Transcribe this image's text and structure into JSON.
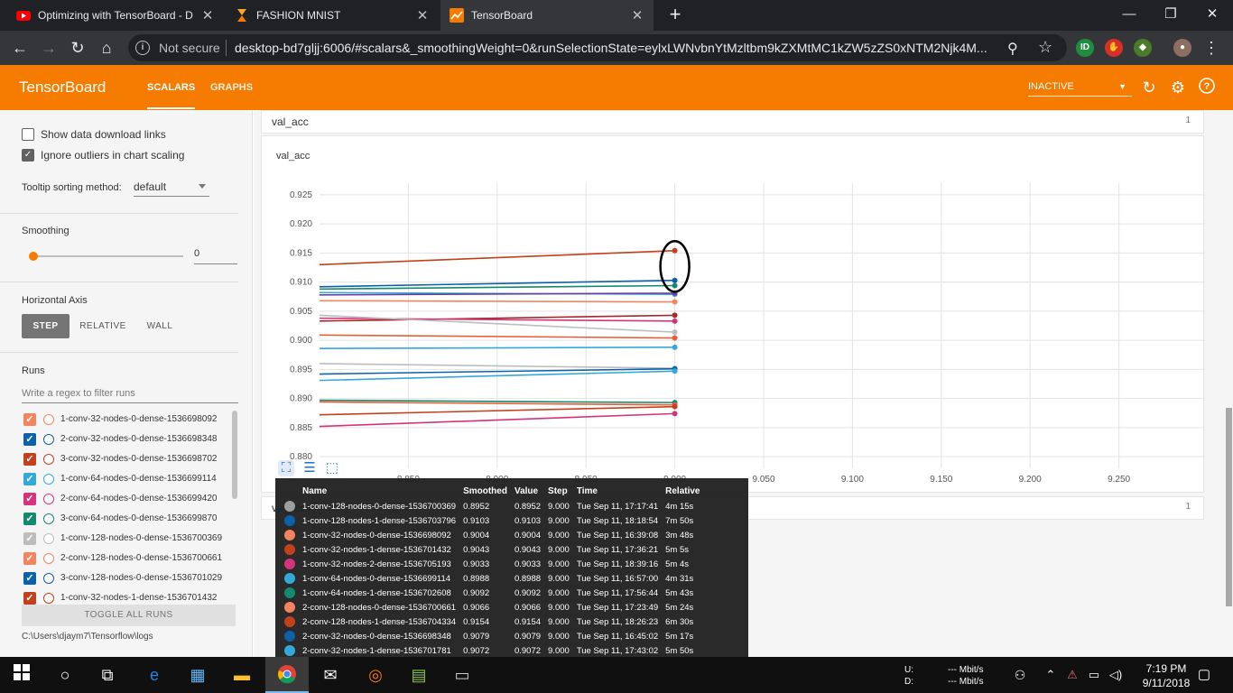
{
  "browser": {
    "tabs": [
      {
        "title": "Optimizing with TensorBoard - D",
        "icon": "youtube-icon"
      },
      {
        "title": "FASHION MNIST",
        "icon": "hourglass-icon"
      },
      {
        "title": "TensorBoard",
        "icon": "tensorboard-icon"
      }
    ],
    "security_label": "Not secure",
    "url": "desktop-bd7gljj:6006/#scalars&_smoothingWeight=0&runSelectionState=eylxLWNvbnYtMzltbm9kZXMtMC1kZW5zZS0xNTM2Njk4M..."
  },
  "tensorboard": {
    "brand": "TensorBoard",
    "nav": [
      "SCALARS",
      "GRAPHS"
    ],
    "status": "INACTIVE",
    "accent": "#f57c00"
  },
  "sidebar": {
    "show_download_links": "Show data download links",
    "ignore_outliers": "Ignore outliers in chart scaling",
    "tooltip_sorting_label": "Tooltip sorting method:",
    "tooltip_sorting_value": "default",
    "smoothing_label": "Smoothing",
    "smoothing_value": "0",
    "horizontal_axis_label": "Horizontal Axis",
    "axis_options": [
      "STEP",
      "RELATIVE",
      "WALL"
    ],
    "runs_label": "Runs",
    "runs_filter_placeholder": "Write a regex to filter runs",
    "runs": [
      {
        "name": "1-conv-32-nodes-0-dense-1536698092",
        "color": "#f4845f"
      },
      {
        "name": "2-conv-32-nodes-0-dense-1536698348",
        "color": "#0c61a8"
      },
      {
        "name": "3-conv-32-nodes-0-dense-1536698702",
        "color": "#c2401c"
      },
      {
        "name": "1-conv-64-nodes-0-dense-1536699114",
        "color": "#33a9d9"
      },
      {
        "name": "2-conv-64-nodes-0-dense-1536699420",
        "color": "#d6337a"
      },
      {
        "name": "3-conv-64-nodes-0-dense-1536699870",
        "color": "#138a6e"
      },
      {
        "name": "1-conv-128-nodes-0-dense-1536700369",
        "color": "#bdbdbd"
      },
      {
        "name": "2-conv-128-nodes-0-dense-1536700661",
        "color": "#f4845f"
      },
      {
        "name": "3-conv-128-nodes-0-dense-1536701029",
        "color": "#0c61a8"
      },
      {
        "name": "1-conv-32-nodes-1-dense-1536701432",
        "color": "#c2401c"
      }
    ],
    "toggle_all": "TOGGLE ALL RUNS",
    "logdir": "C:\\Users\\djaym7\\Tensorflow\\logs"
  },
  "main": {
    "card_title": "val_acc",
    "card_count": "1",
    "chart_title": "val_acc",
    "second_card_title": "val_loss",
    "second_card_count": "1"
  },
  "chart_data": {
    "type": "line",
    "title": "val_acc",
    "xlabel": "",
    "ylabel": "",
    "xlim": [
      8.8,
      9.3
    ],
    "ylim": [
      0.878,
      0.927
    ],
    "x_ticks": [
      "8.850",
      "8.900",
      "8.950",
      "9.000",
      "9.050",
      "9.100",
      "9.150",
      "9.200",
      "9.250"
    ],
    "y_ticks": [
      "0.925",
      "0.920",
      "0.915",
      "0.910",
      "0.905",
      "0.900",
      "0.895",
      "0.890",
      "0.885",
      "0.880"
    ],
    "grid": true,
    "series": [
      {
        "color": "#c2401c",
        "x": [
          8.8,
          9.0
        ],
        "values": [
          0.913,
          0.9154
        ]
      },
      {
        "color": "#0c61a8",
        "x": [
          8.8,
          9.0
        ],
        "values": [
          0.9092,
          0.9103
        ]
      },
      {
        "color": "#138a6e",
        "x": [
          8.8,
          9.0
        ],
        "values": [
          0.9088,
          0.9094
        ]
      },
      {
        "color": "#33a9d9",
        "x": [
          8.8,
          9.0
        ],
        "values": [
          0.9082,
          0.9079
        ]
      },
      {
        "color": "#6b3fa0",
        "x": [
          8.8,
          9.0
        ],
        "values": [
          0.9078,
          0.9081
        ]
      },
      {
        "color": "#f4845f",
        "x": [
          8.8,
          9.0
        ],
        "values": [
          0.9068,
          0.9066
        ]
      },
      {
        "color": "#a52a2a",
        "x": [
          8.8,
          9.0
        ],
        "values": [
          0.9033,
          0.9043
        ]
      },
      {
        "color": "#d6337a",
        "x": [
          8.8,
          9.0
        ],
        "values": [
          0.9038,
          0.9033
        ]
      },
      {
        "color": "#bdbdbd",
        "x": [
          8.8,
          9.0
        ],
        "values": [
          0.9043,
          0.9014
        ]
      },
      {
        "color": "#e85d3b",
        "x": [
          8.8,
          9.0
        ],
        "values": [
          0.9009,
          0.9004
        ]
      },
      {
        "color": "#33a9d9",
        "x": [
          8.8,
          9.0
        ],
        "values": [
          0.8986,
          0.8988
        ]
      },
      {
        "color": "#bdbdbd",
        "x": [
          8.8,
          9.0
        ],
        "values": [
          0.896,
          0.8952
        ]
      },
      {
        "color": "#0c61a8",
        "x": [
          8.8,
          9.0
        ],
        "values": [
          0.8942,
          0.8951
        ]
      },
      {
        "color": "#33a9d9",
        "x": [
          8.8,
          9.0
        ],
        "values": [
          0.8931,
          0.8947
        ]
      },
      {
        "color": "#138a6e",
        "x": [
          8.8,
          9.0
        ],
        "values": [
          0.8897,
          0.8893
        ]
      },
      {
        "color": "#e85d3b",
        "x": [
          8.8,
          9.0
        ],
        "values": [
          0.8894,
          0.8889
        ]
      },
      {
        "color": "#c2401c",
        "x": [
          8.8,
          9.0
        ],
        "values": [
          0.8872,
          0.8886
        ]
      },
      {
        "color": "#d6337a",
        "x": [
          8.8,
          9.0
        ],
        "values": [
          0.8852,
          0.8874
        ]
      }
    ]
  },
  "tooltip": {
    "headers": [
      "Name",
      "Smoothed",
      "Value",
      "Step",
      "Time",
      "Relative"
    ],
    "rows": [
      {
        "color": "#9e9e9e",
        "name": "1-conv-128-nodes-0-dense-1536700369",
        "smoothed": "0.8952",
        "value": "0.8952",
        "step": "9.000",
        "time": "Tue Sep 11, 17:17:41",
        "relative": "4m 15s"
      },
      {
        "color": "#0c61a8",
        "name": "1-conv-128-nodes-1-dense-1536703796",
        "smoothed": "0.9103",
        "value": "0.9103",
        "step": "9.000",
        "time": "Tue Sep 11, 18:18:54",
        "relative": "7m 50s"
      },
      {
        "color": "#f4845f",
        "name": "1-conv-32-nodes-0-dense-1536698092",
        "smoothed": "0.9004",
        "value": "0.9004",
        "step": "9.000",
        "time": "Tue Sep 11, 16:39:08",
        "relative": "3m 48s"
      },
      {
        "color": "#c2401c",
        "name": "1-conv-32-nodes-1-dense-1536701432",
        "smoothed": "0.9043",
        "value": "0.9043",
        "step": "9.000",
        "time": "Tue Sep 11, 17:36:21",
        "relative": "5m 5s"
      },
      {
        "color": "#d6337a",
        "name": "1-conv-32-nodes-2-dense-1536705193",
        "smoothed": "0.9033",
        "value": "0.9033",
        "step": "9.000",
        "time": "Tue Sep 11, 18:39:16",
        "relative": "5m 4s"
      },
      {
        "color": "#33a9d9",
        "name": "1-conv-64-nodes-0-dense-1536699114",
        "smoothed": "0.8988",
        "value": "0.8988",
        "step": "9.000",
        "time": "Tue Sep 11, 16:57:00",
        "relative": "4m 31s"
      },
      {
        "color": "#138a6e",
        "name": "1-conv-64-nodes-1-dense-1536702608",
        "smoothed": "0.9092",
        "value": "0.9092",
        "step": "9.000",
        "time": "Tue Sep 11, 17:56:44",
        "relative": "5m 43s"
      },
      {
        "color": "#f4845f",
        "name": "2-conv-128-nodes-0-dense-1536700661",
        "smoothed": "0.9066",
        "value": "0.9066",
        "step": "9.000",
        "time": "Tue Sep 11, 17:23:49",
        "relative": "5m 24s"
      },
      {
        "color": "#c2401c",
        "name": "2-conv-128-nodes-1-dense-1536704334",
        "smoothed": "0.9154",
        "value": "0.9154",
        "step": "9.000",
        "time": "Tue Sep 11, 18:26:23",
        "relative": "6m 30s"
      },
      {
        "color": "#0c61a8",
        "name": "2-conv-32-nodes-0-dense-1536698348",
        "smoothed": "0.9079",
        "value": "0.9079",
        "step": "9.000",
        "time": "Tue Sep 11, 16:45:02",
        "relative": "5m 17s"
      },
      {
        "color": "#33a9d9",
        "name": "2-conv-32-nodes-1-dense-1536701781",
        "smoothed": "0.9072",
        "value": "0.9072",
        "step": "9.000",
        "time": "Tue Sep 11, 17:43:02",
        "relative": "5m 50s"
      }
    ]
  },
  "taskbar": {
    "net_up_label": "U:",
    "net_down_label": "D:",
    "net_up": "--- Mbit/s",
    "net_down": "--- Mbit/s",
    "time": "7:19 PM",
    "date": "9/11/2018"
  }
}
